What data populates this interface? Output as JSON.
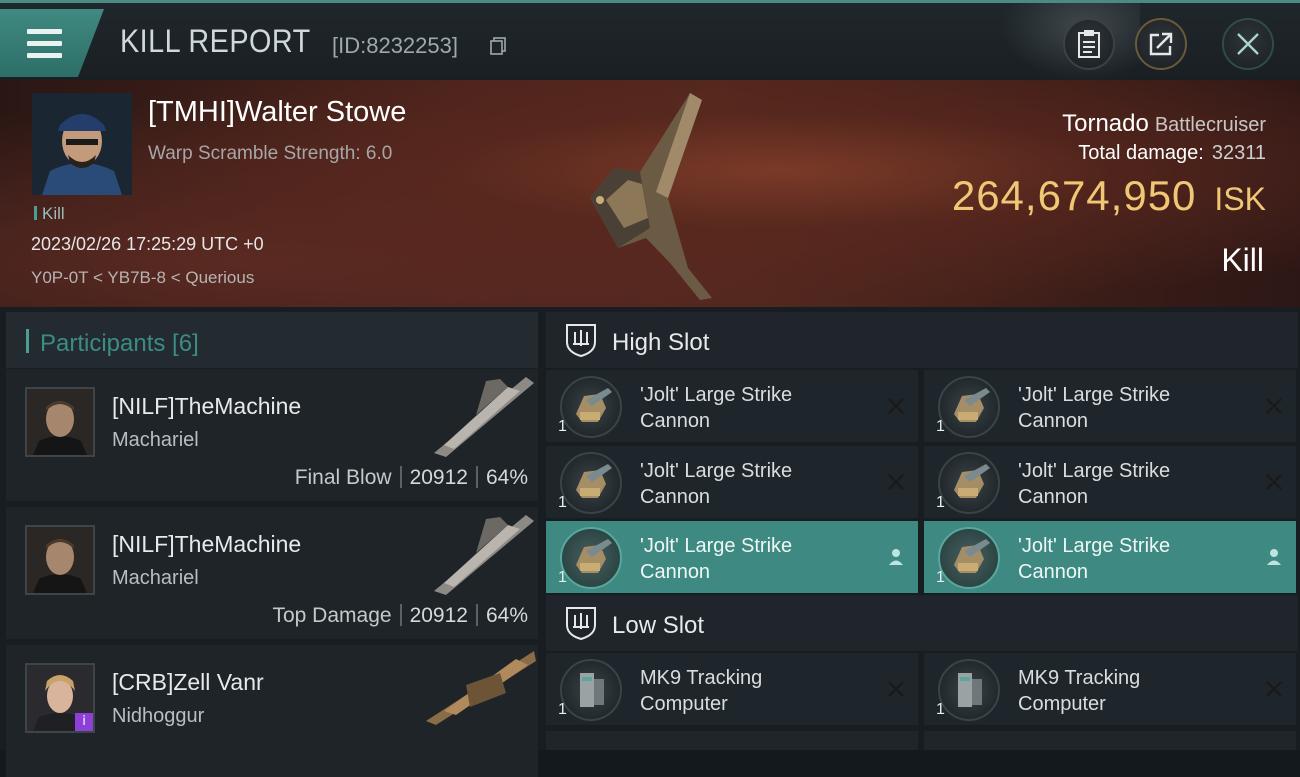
{
  "header": {
    "title": "KILL REPORT",
    "report_id": "[ID:8232253]"
  },
  "victim": {
    "name": "[TMHI]Walter Stowe",
    "warp_scramble": "Warp Scramble Strength: 6.0",
    "kill_tag": "Kill",
    "timestamp": "2023/02/26 17:25:29 UTC +0",
    "location": "Y0P-0T < YB7B-8 < Querious",
    "ship_name": "Tornado",
    "ship_class": "Battlecruiser",
    "total_damage_label": "Total damage:",
    "total_damage": "32311",
    "isk_value": "264,674,950",
    "isk_unit": "ISK",
    "result": "Kill"
  },
  "participants": {
    "title": "Participants [6]",
    "items": [
      {
        "name": "[NILF]TheMachine",
        "ship": "Machariel",
        "role": "Final Blow",
        "damage": "20912",
        "percent": "64%"
      },
      {
        "name": "[NILF]TheMachine",
        "ship": "Machariel",
        "role": "Top Damage",
        "damage": "20912",
        "percent": "64%"
      },
      {
        "name": "[CRB]Zell Vanr",
        "ship": "Nidhoggur",
        "badge": "i"
      }
    ]
  },
  "slots": {
    "high": {
      "title": "High Slot",
      "modules": [
        {
          "line1": "'Jolt' Large Strike",
          "line2": "Cannon",
          "qty": "1",
          "state": "destroyed"
        },
        {
          "line1": "'Jolt' Large Strike",
          "line2": "Cannon",
          "qty": "1",
          "state": "destroyed"
        },
        {
          "line1": "'Jolt' Large Strike",
          "line2": "Cannon",
          "qty": "1",
          "state": "destroyed"
        },
        {
          "line1": "'Jolt' Large Strike",
          "line2": "Cannon",
          "qty": "1",
          "state": "destroyed"
        },
        {
          "line1": "'Jolt' Large Strike",
          "line2": "Cannon",
          "qty": "1",
          "state": "dropped"
        },
        {
          "line1": "'Jolt' Large Strike",
          "line2": "Cannon",
          "qty": "1",
          "state": "dropped"
        }
      ]
    },
    "low": {
      "title": "Low Slot",
      "modules": [
        {
          "line1": "MK9 Tracking",
          "line2": "Computer",
          "qty": "1",
          "state": "destroyed"
        },
        {
          "line1": "MK9 Tracking",
          "line2": "Computer",
          "qty": "1",
          "state": "destroyed"
        }
      ]
    }
  },
  "colors": {
    "accent": "#3e8a82",
    "isk_gold": "#f0c774",
    "background": "#14191d"
  },
  "icons": {
    "menu": "hamburger-icon",
    "copy": "copy-icon",
    "clipboard": "clipboard-icon",
    "share": "share-icon",
    "close": "close-icon",
    "slot": "shield-icon",
    "destroyed": "x-mark-icon",
    "dropped": "person-icon"
  }
}
